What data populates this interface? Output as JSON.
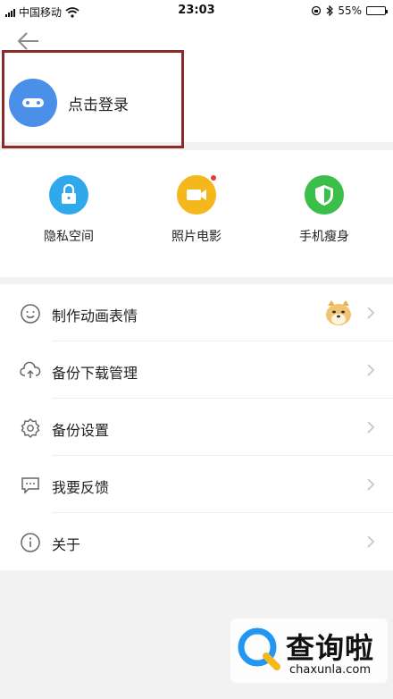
{
  "status_bar": {
    "carrier": "中国移动",
    "time": "23:03",
    "battery": "55%",
    "battery_level": 0.55
  },
  "header": {
    "back_icon": "arrow-left-icon"
  },
  "login": {
    "text": "点击登录",
    "avatar_color": "#4a90e8"
  },
  "features": [
    {
      "label": "隐私空间",
      "icon": "lock-icon",
      "color": "#2fa8ec"
    },
    {
      "label": "照片电影",
      "icon": "video-camera-icon",
      "color": "#f5b81c"
    },
    {
      "label": "手机瘦身",
      "icon": "shield-icon",
      "color": "#3cbf4a"
    }
  ],
  "menu": [
    {
      "label": "制作动画表情",
      "icon": "smiley-icon"
    },
    {
      "label": "备份下载管理",
      "icon": "cloud-upload-icon"
    },
    {
      "label": "备份设置",
      "icon": "gear-icon"
    },
    {
      "label": "我要反馈",
      "icon": "message-icon"
    },
    {
      "label": "关于",
      "icon": "info-icon"
    }
  ],
  "watermark": {
    "title": "查询啦",
    "url": "chaxunla.com"
  }
}
